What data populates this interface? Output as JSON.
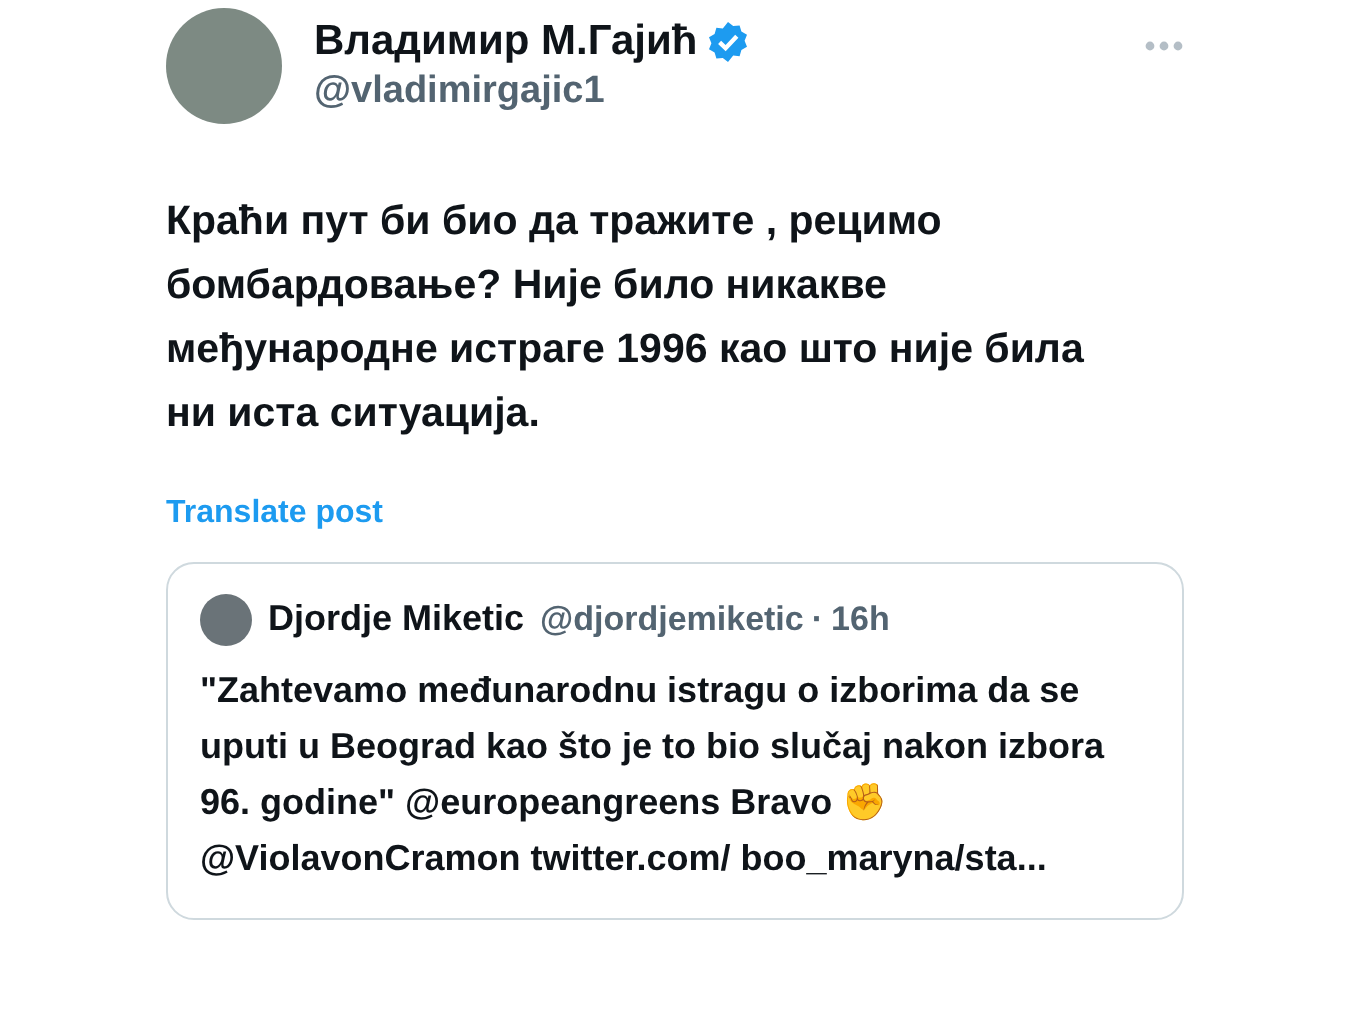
{
  "author": {
    "name": "Владимир М.Гајић",
    "verified": true,
    "handle": "@vladimirgajic1"
  },
  "post_text": "Краћи пут би био да тражите , рецимо бомбардовање? Није било никакве међународне истраге 1996 као што није била ни иста ситуација.",
  "translate_link": "Translate post",
  "quoted_post": {
    "name": "Djordje Miketic",
    "handle": "@djordjemiketic",
    "separator": "·",
    "time": "16h",
    "text": "\"Zahtevamo međunarodnu istragu o izborima da se uputi u Beograd kao što je to bio slučaj nakon izbora 96. godine\" @europeangreens Bravo ✊ @ViolavonCramon twitter.com/ boo_maryna/sta..."
  }
}
